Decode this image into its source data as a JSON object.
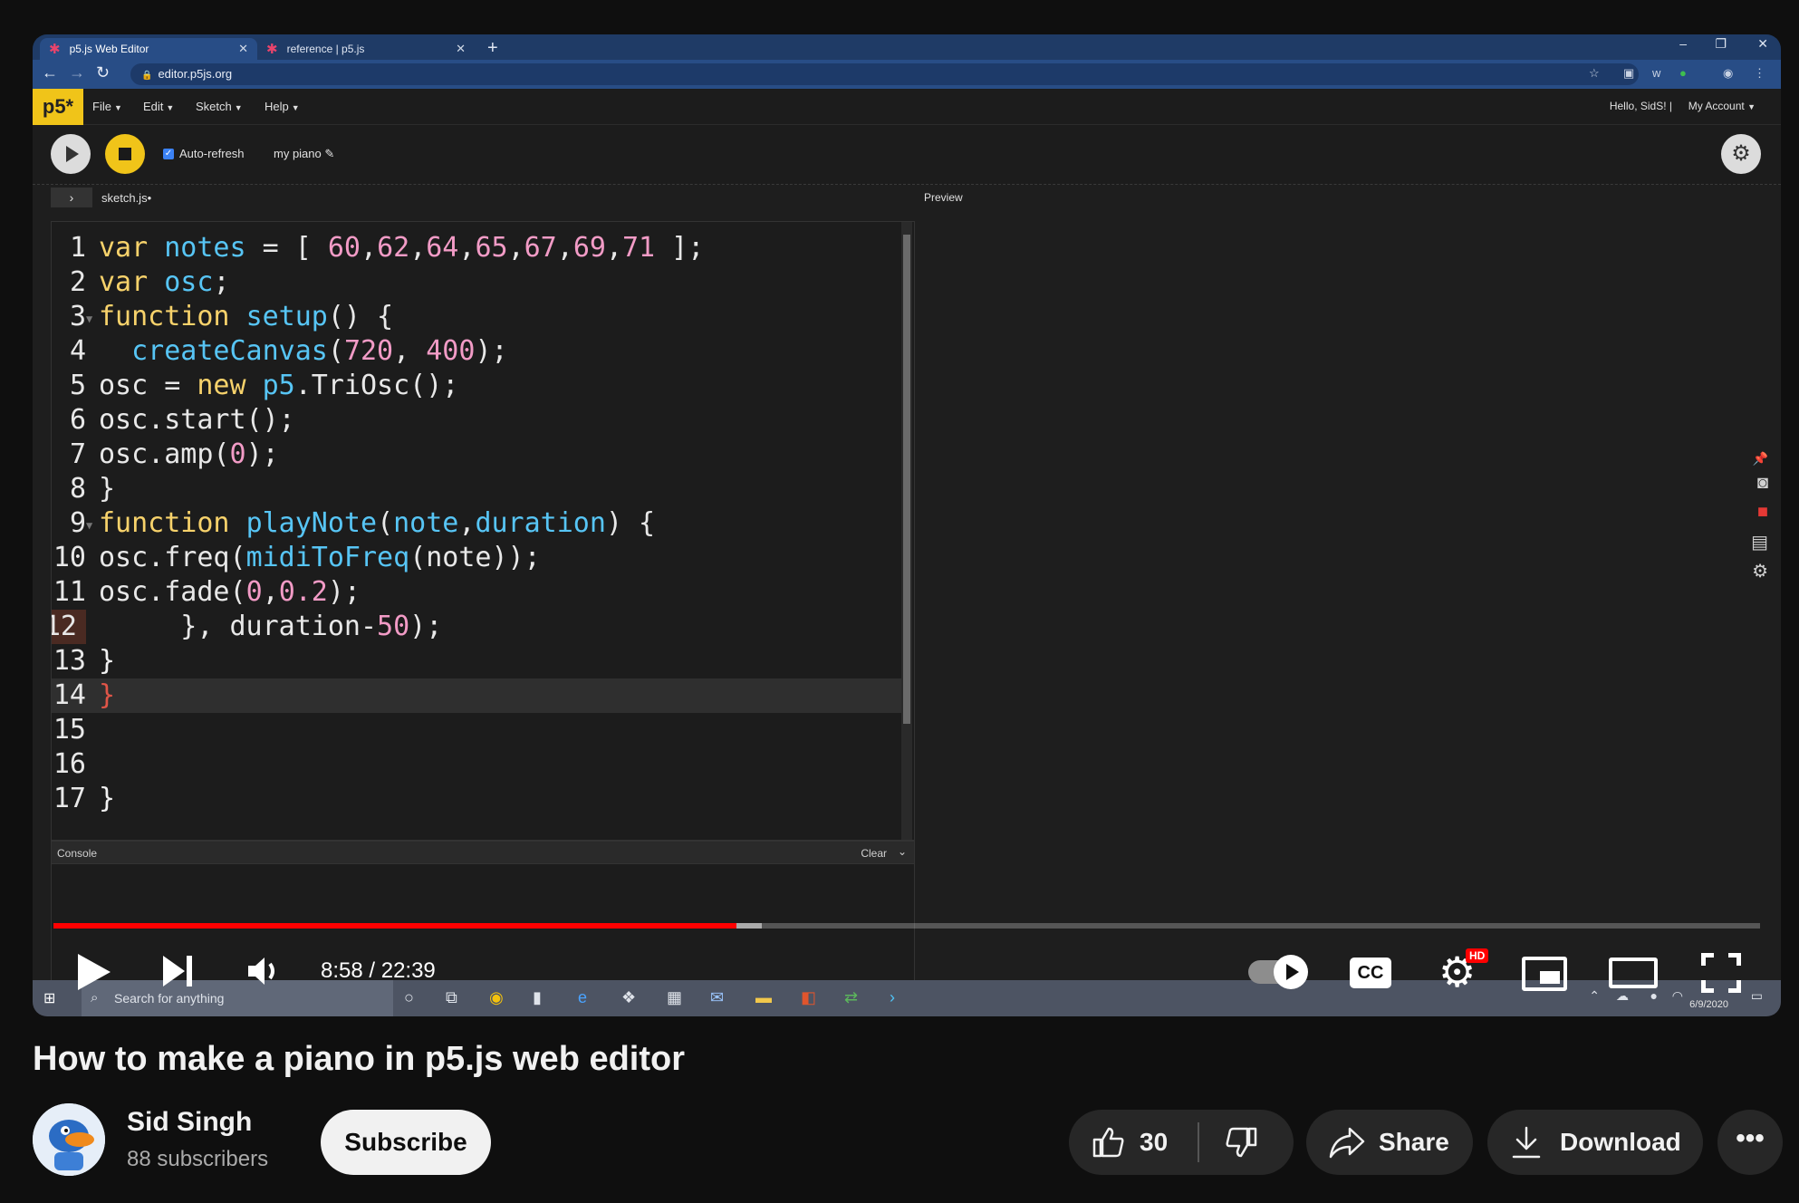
{
  "browser": {
    "tabs": [
      {
        "title": "p5.js Web Editor"
      },
      {
        "title": "reference | p5.js"
      }
    ],
    "url": "editor.p5js.org"
  },
  "p5_editor": {
    "logo": "p5*",
    "menus": [
      "File",
      "Edit",
      "Sketch",
      "Help"
    ],
    "greeting": "Hello, SidS!",
    "account_label": "My Account",
    "auto_refresh_label": "Auto-refresh",
    "sketch_name": "my piano",
    "file_name": "sketch.js",
    "preview_label": "Preview",
    "console_label": "Console",
    "clear_label": "Clear",
    "code_lines": [
      {
        "num": "1",
        "text": "var notes = [ 60,62,64,65,67,69,71 ];"
      },
      {
        "num": "2",
        "text": "var osc;"
      },
      {
        "num": "3",
        "text": "function setup() {"
      },
      {
        "num": "4",
        "text": "  createCanvas(720, 400);"
      },
      {
        "num": "5",
        "text": "osc = new p5.TriOsc();"
      },
      {
        "num": "6",
        "text": "osc.start();"
      },
      {
        "num": "7",
        "text": "osc.amp(0);"
      },
      {
        "num": "8",
        "text": "}"
      },
      {
        "num": "9",
        "text": "function playNote(note,duration) {"
      },
      {
        "num": "10",
        "text": "osc.freq(midiToFreq(note));"
      },
      {
        "num": "11",
        "text": "osc.fade(0,0.2);"
      },
      {
        "num": "12",
        "text": "     }, duration-50);"
      },
      {
        "num": "13",
        "text": "}"
      },
      {
        "num": "14",
        "text": "}"
      },
      {
        "num": "15",
        "text": ""
      },
      {
        "num": "16",
        "text": ""
      },
      {
        "num": "17",
        "text": "}"
      }
    ]
  },
  "taskbar": {
    "search_placeholder": "Search for anything",
    "date": "6/9/2020"
  },
  "player": {
    "time": "8:58 / 22:39",
    "progress_played": 0.4,
    "progress_buffered": 0.415,
    "hd_badge": "HD",
    "cc_label": "CC"
  },
  "video": {
    "title": "How to make a piano in p5.js web editor",
    "channel_name": "Sid Singh",
    "subscribers": "88 subscribers",
    "subscribe_label": "Subscribe",
    "likes": "30",
    "share_label": "Share",
    "download_label": "Download"
  }
}
